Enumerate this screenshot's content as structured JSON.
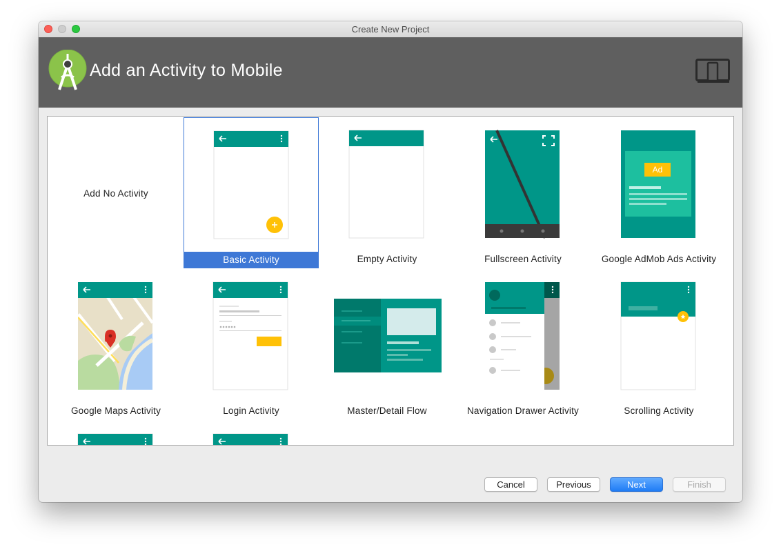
{
  "window": {
    "title": "Create New Project"
  },
  "header": {
    "title": "Add an Activity to Mobile",
    "logo_icon": "android-studio-logo",
    "device_icon": "phone-tablet-icon"
  },
  "gallery": {
    "selected": "Basic Activity",
    "items": [
      {
        "label": "Add No Activity"
      },
      {
        "label": "Basic Activity"
      },
      {
        "label": "Empty Activity"
      },
      {
        "label": "Fullscreen Activity"
      },
      {
        "label": "Google AdMob Ads Activity",
        "badge": "Ad"
      },
      {
        "label": "Google Maps Activity"
      },
      {
        "label": "Login Activity"
      },
      {
        "label": "Master/Detail Flow"
      },
      {
        "label": "Navigation Drawer Activity"
      },
      {
        "label": "Scrolling Activity"
      }
    ]
  },
  "buttons": {
    "cancel": "Cancel",
    "previous": "Previous",
    "next": "Next",
    "finish": "Finish"
  },
  "colors": {
    "teal": "#009688",
    "teal_dark": "#00796b",
    "accent": "#ffc107",
    "selection": "#3e78d6",
    "header": "#5f5f5f"
  }
}
